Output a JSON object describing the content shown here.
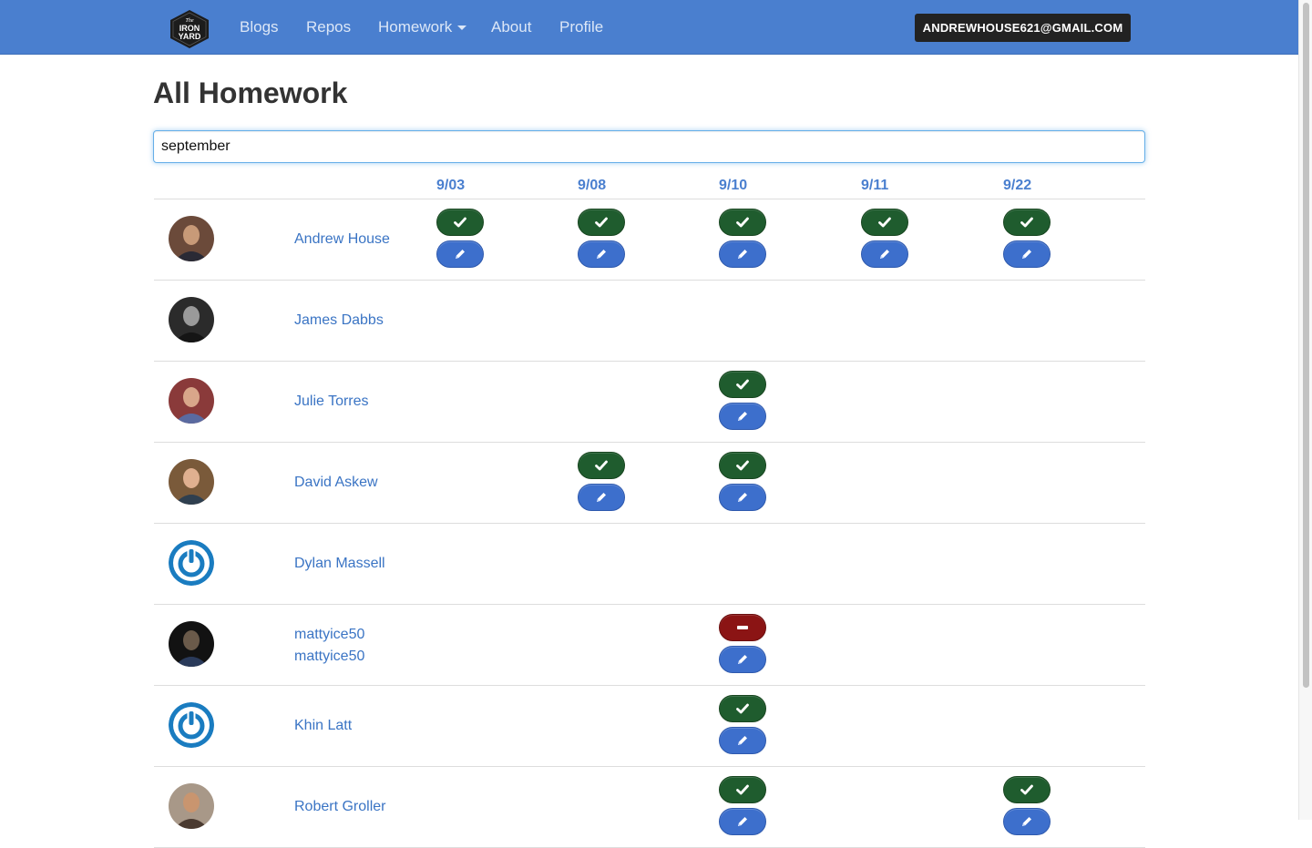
{
  "navbar": {
    "logo_lines": [
      "The",
      "IRON",
      "YARD"
    ],
    "items": [
      {
        "label": "Blogs"
      },
      {
        "label": "Repos"
      },
      {
        "label": "Homework"
      },
      {
        "label": "About"
      },
      {
        "label": "Profile"
      }
    ],
    "user_email": "ANDREWHOUSE621@GMAIL.COM"
  },
  "page": {
    "title": "All Homework",
    "search_value": "september"
  },
  "columns": [
    "9/03",
    "9/08",
    "9/10",
    "9/11",
    "9/22"
  ],
  "colors": {
    "navbar": "#4a7fcf",
    "done": "#1f5c2e",
    "missing": "#8b1414",
    "edit": "#3d6fcc",
    "link": "#3a74c4"
  },
  "students": [
    {
      "name": "Andrew House",
      "avatar": "photo-avatar",
      "status": [
        "done",
        "done",
        "done",
        "done",
        "done"
      ]
    },
    {
      "name": "James Dabbs",
      "avatar": "photo-avatar",
      "status": [
        null,
        null,
        null,
        null,
        null
      ]
    },
    {
      "name": "Julie Torres",
      "avatar": "photo-avatar",
      "status": [
        null,
        null,
        "done",
        null,
        null
      ]
    },
    {
      "name": "David Askew",
      "avatar": "photo-avatar",
      "status": [
        null,
        "done",
        "done",
        null,
        null
      ]
    },
    {
      "name": "Dylan Massell",
      "avatar": "power-icon",
      "status": [
        null,
        null,
        null,
        null,
        null
      ]
    },
    {
      "name": "mattyice50",
      "name2": "mattyice50",
      "avatar": "photo-avatar",
      "status": [
        null,
        null,
        "missing",
        null,
        null
      ]
    },
    {
      "name": "Khin Latt",
      "avatar": "power-icon",
      "status": [
        null,
        null,
        "done",
        null,
        null
      ]
    },
    {
      "name": "Robert Groller",
      "avatar": "photo-avatar",
      "status": [
        null,
        null,
        "done",
        null,
        "done"
      ]
    }
  ]
}
